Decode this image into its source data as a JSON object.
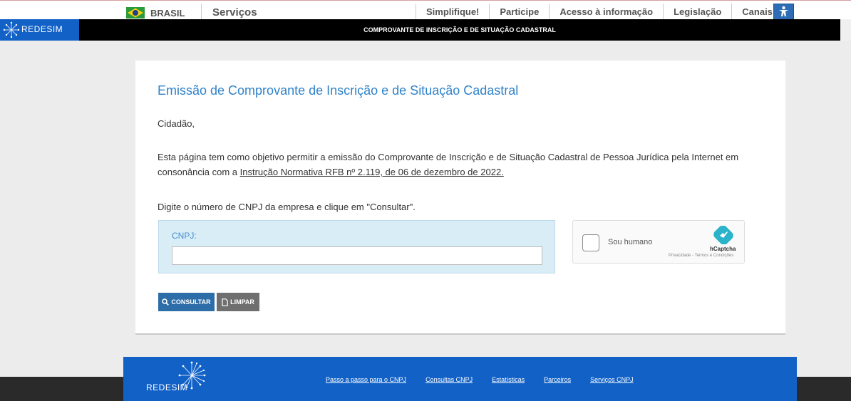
{
  "gov_bar": {
    "country": "BRASIL",
    "services": "Serviços",
    "links": [
      "Simplifique!",
      "Participe",
      "Acesso à informação",
      "Legislação",
      "Canais"
    ]
  },
  "strip": {
    "logo": "REDESIM",
    "title": "COMPROVANTE DE INSCRIÇÃO E DE SITUAÇÃO CADASTRAL"
  },
  "main": {
    "heading": "Emissão de Comprovante de Inscrição e de Situação Cadastral",
    "greeting": "Cidadão,",
    "intro_line1": "Esta página tem como objetivo permitir a emissão do Comprovante de Inscrição e de Situação Cadastral de Pessoa Jurídica pela Internet em",
    "intro_line2_prefix": "consonância com a ",
    "intro_link": "Instrução Normativa RFB nº 2.119, de 06 de dezembro de 2022.",
    "instruction": "Digite o número de CNPJ da empresa e clique em \"Consultar\".",
    "cnpj_label": "CNPJ:",
    "cnpj_value": "",
    "captcha": {
      "label": "Sou humano",
      "brand": "hCaptcha",
      "terms": "Privacidade - Termos e Condições"
    },
    "buttons": {
      "consultar": "CONSULTAR",
      "limpar": "LIMPAR"
    }
  },
  "footer": {
    "logo": "REDESIM",
    "links": [
      "Passo a passo para o CNPJ",
      "Consultas CNPJ",
      "Estatísticas",
      "Parceiros",
      "Serviços CNPJ"
    ]
  },
  "colors": {
    "brand_blue": "#1161c7",
    "heading_blue": "#2f82c9",
    "button_blue": "#2e6ea8",
    "button_gray": "#6f6f6f"
  }
}
